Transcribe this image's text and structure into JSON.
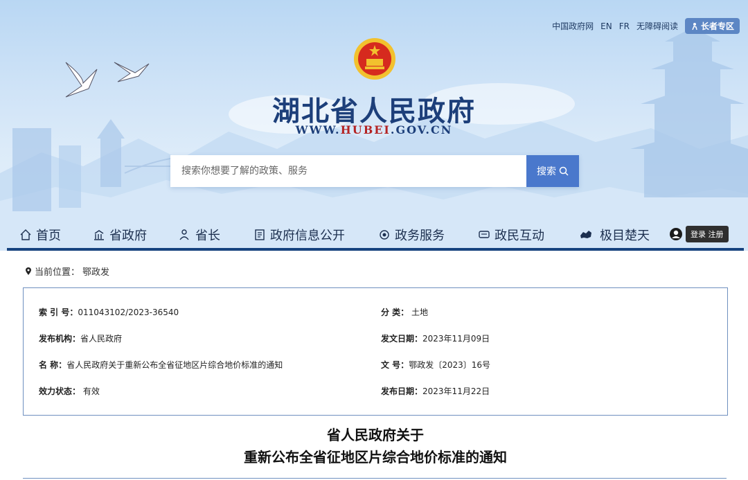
{
  "topbar": {
    "gov_site": "中国政府网",
    "en": "EN",
    "fr": "FR",
    "accessibility": "无障碍阅读",
    "elder": "长者专区"
  },
  "site": {
    "title": "湖北省人民政府",
    "url_prefix": "WWW.",
    "url_mid": "HUBEI",
    "url_suffix": ".GOV.CN"
  },
  "search": {
    "placeholder": "搜索你想要了解的政策、服务",
    "button": "搜索"
  },
  "nav": {
    "items": [
      {
        "label": "首页",
        "icon": "home-icon"
      },
      {
        "label": "省政府",
        "icon": "building-icon"
      },
      {
        "label": "省长",
        "icon": "person-icon"
      },
      {
        "label": "政府信息公开",
        "icon": "document-icon"
      },
      {
        "label": "政务服务",
        "icon": "service-icon"
      },
      {
        "label": "政民互动",
        "icon": "chat-icon"
      },
      {
        "label": "极目楚天",
        "icon": "map-icon"
      }
    ],
    "login": "登录 注册"
  },
  "breadcrumb": {
    "prefix": "当前位置：",
    "current": "鄂政发"
  },
  "meta": {
    "index_label": "索 引 号：",
    "index_value": "011043102/2023-36540",
    "category_label": "分 类：",
    "category_value": "土地",
    "issuer_label": "发布机构：",
    "issuer_value": "省人民政府",
    "issue_date_label": "发文日期：",
    "issue_date_value": "2023年11月09日",
    "name_label": "名 称：",
    "name_value": "省人民政府关于重新公布全省征地区片综合地价标准的通知",
    "doc_no_label": "文 号：",
    "doc_no_value": "鄂政发〔2023〕16号",
    "status_label": "效力状态：",
    "status_value": "有效",
    "publish_date_label": "发布日期：",
    "publish_date_value": "2023年11月22日"
  },
  "document": {
    "title_line1": "省人民政府关于",
    "title_line2": "重新公布全省征地区片综合地价标准的通知"
  },
  "colors": {
    "nav_line": "#17437f",
    "title": "#1d3f7a",
    "search_button": "#4a78cc",
    "border": "#6e8fbf"
  }
}
